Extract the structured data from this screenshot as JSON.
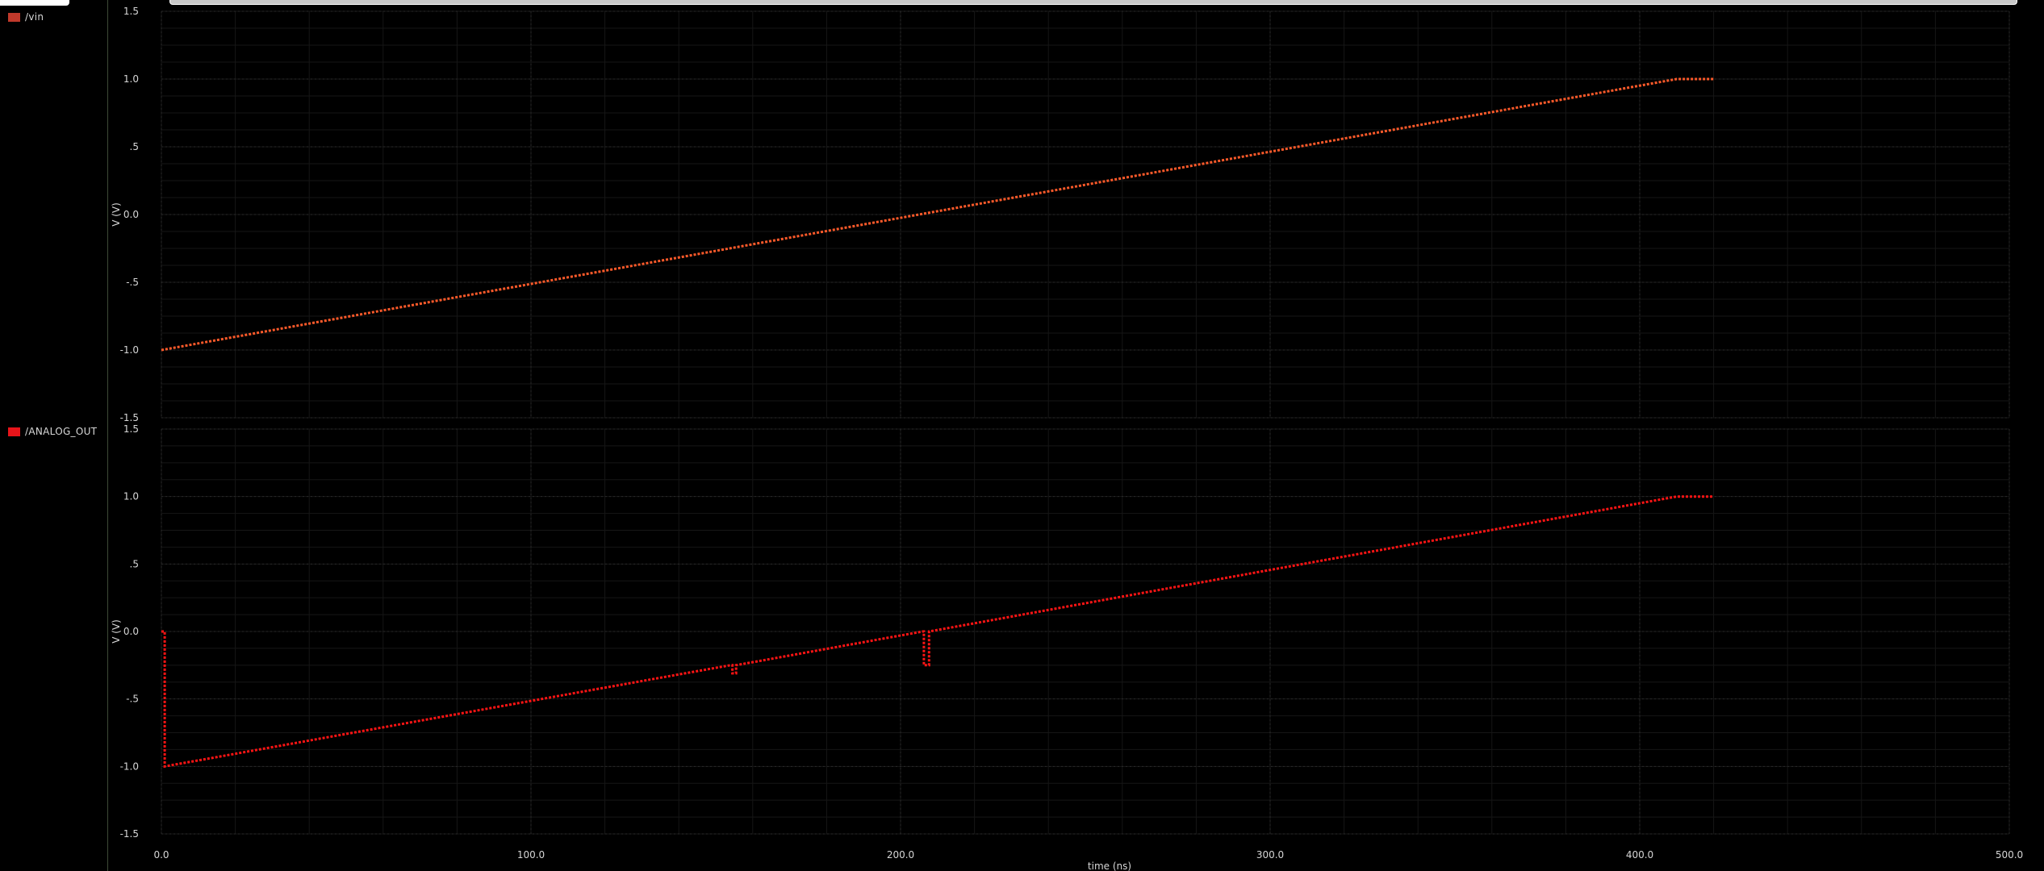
{
  "legend": {
    "panes": [
      {
        "label": "/vin",
        "color": "#c0392b"
      },
      {
        "label": "/ANALOG_OUT",
        "color": "#e8141a"
      }
    ]
  },
  "colors": {
    "background": "#000000",
    "grid_major": "#2a2a2a",
    "grid_minor": "#161616",
    "axis_text": "#d6d6d6",
    "vin_trace": "#ff5a2a",
    "out_trace": "#ff1414"
  },
  "chart_data": [
    {
      "type": "line",
      "xlabel": "",
      "ylabel": "V (V)",
      "xlim": [
        0,
        500
      ],
      "ylim": [
        -1.5,
        1.5
      ],
      "x_ticks": [
        "0.0",
        "100.0",
        "200.0",
        "300.0",
        "400.0",
        "500.0"
      ],
      "y_ticks": [
        "1.5",
        "1.0",
        ".5",
        "0.0",
        "-.5",
        "-1.0",
        "-1.5"
      ],
      "grid": true,
      "series": [
        {
          "name": "/vin",
          "x": [
            0,
            410,
            420
          ],
          "y": [
            -1.0,
            1.0,
            1.0
          ]
        }
      ]
    },
    {
      "type": "line",
      "xlabel": "time (ns)",
      "ylabel": "V (V)",
      "xlim": [
        0,
        500
      ],
      "ylim": [
        -1.5,
        1.5
      ],
      "x_ticks": [
        "0.0",
        "100.0",
        "200.0",
        "300.0",
        "400.0",
        "500.0"
      ],
      "y_ticks": [
        "1.5",
        "1.0",
        ".5",
        "0.0",
        "-.5",
        "-1.0",
        "-1.5"
      ],
      "grid": true,
      "series": [
        {
          "name": "/ANALOG_OUT",
          "x": [
            0,
            0.9,
            0.9,
            154,
            154.5,
            154.5,
            155.5,
            155.5,
            206,
            206.3,
            206.3,
            207.7,
            207.7,
            410,
            420
          ],
          "y": [
            0.0,
            0.0,
            -1.0,
            -0.25,
            -0.25,
            -0.31,
            -0.31,
            -0.25,
            -0.0,
            -0.0,
            -0.25,
            -0.25,
            0.0,
            1.0,
            1.0
          ]
        }
      ]
    }
  ]
}
